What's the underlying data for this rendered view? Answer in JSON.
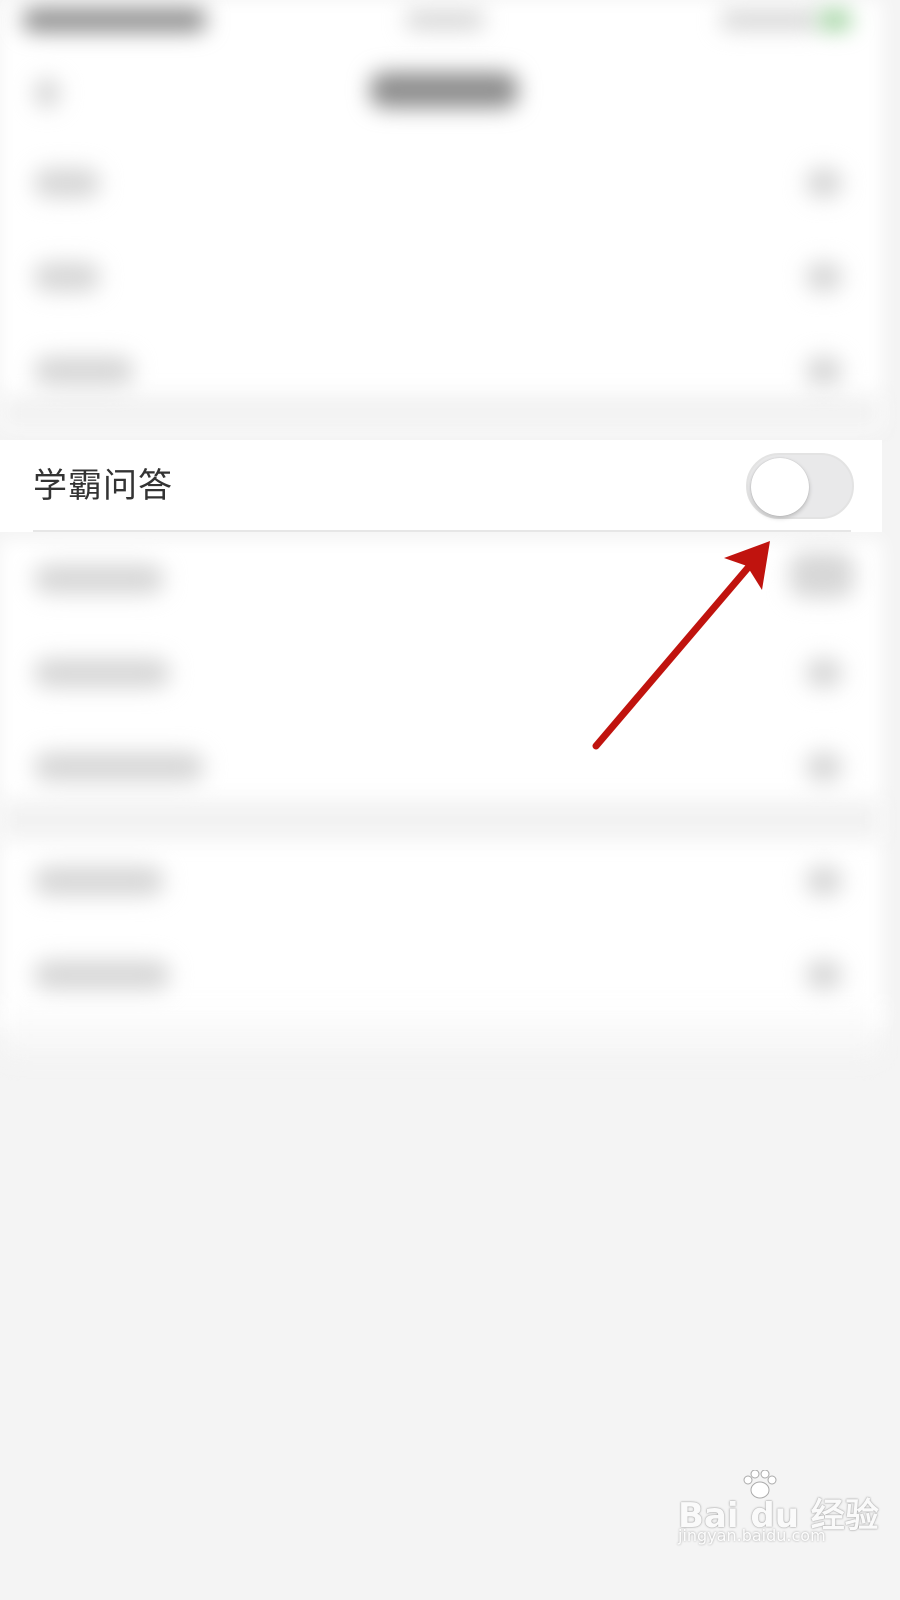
{
  "setting": {
    "label": "学霸问答",
    "toggle_state": "off"
  },
  "annotation": {
    "arrow_color": "#c0130e"
  },
  "watermark": {
    "brand": "Bai du 经验",
    "url": "jingyan.baidu.com"
  },
  "colors": {
    "background": "#f4f4f4",
    "row_background": "#ffffff",
    "toggle_track": "#e9e9ea",
    "label_text": "#333333"
  }
}
